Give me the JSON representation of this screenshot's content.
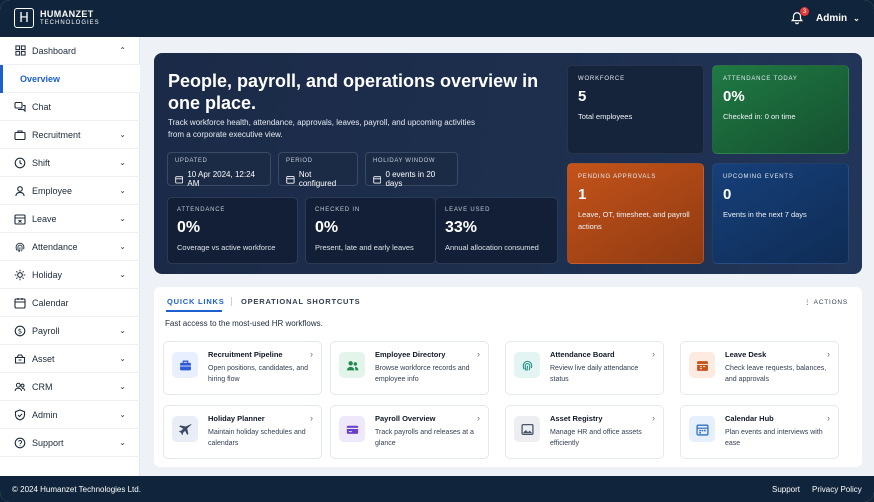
{
  "brand": {
    "main": "HUMANZET",
    "sub": "TECHNOLOGIES",
    "mark": "H"
  },
  "header": {
    "notification_count": "3",
    "user_label": "Admin"
  },
  "sidebar": {
    "items": [
      {
        "label": "Dashboard",
        "icon": "grid-icon"
      },
      {
        "label": "Overview",
        "icon": ""
      },
      {
        "label": "Chat",
        "icon": "chat-icon"
      },
      {
        "label": "Recruitment",
        "icon": "briefcase-icon"
      },
      {
        "label": "Shift",
        "icon": "clock-icon"
      },
      {
        "label": "Employee",
        "icon": "user-icon"
      },
      {
        "label": "Leave",
        "icon": "calendar-x-icon"
      },
      {
        "label": "Attendance",
        "icon": "fingerprint-icon"
      },
      {
        "label": "Holiday",
        "icon": "sun-icon"
      },
      {
        "label": "Calendar",
        "icon": "calendar-icon"
      },
      {
        "label": "Payroll",
        "icon": "dollar-icon"
      },
      {
        "label": "Asset",
        "icon": "box-icon"
      },
      {
        "label": "CRM",
        "icon": "users-icon"
      },
      {
        "label": "Admin",
        "icon": "shield-icon"
      },
      {
        "label": "Support",
        "icon": "help-icon"
      }
    ]
  },
  "hero": {
    "title": "People, payroll, and operations overview in one place.",
    "description": "Track workforce health, attendance, approvals, leaves, payroll, and upcoming activities from a corporate executive view.",
    "meta": [
      {
        "key": "UPDATED",
        "value": "10 Apr 2024, 12:24 AM"
      },
      {
        "key": "PERIOD",
        "value": "Not configured"
      },
      {
        "key": "HOLIDAY WINDOW",
        "value": "0 events in 20 days"
      }
    ],
    "stats": [
      {
        "key": "ATTENDANCE",
        "value": "0%",
        "desc": "Coverage vs active workforce"
      },
      {
        "key": "CHECKED IN",
        "value": "0%",
        "desc": "Present, late and early leaves"
      },
      {
        "key": "LEAVE USED",
        "value": "33%",
        "desc": "Annual allocation consumed"
      }
    ],
    "kpis": [
      {
        "key": "WORKFORCE",
        "value": "5",
        "desc": "Total employees",
        "color": "#15233b"
      },
      {
        "key": "ATTENDANCE TODAY",
        "value": "0%",
        "desc": "Checked in: 0 on time",
        "color": "#1b6a3a"
      },
      {
        "key": "PENDING APPROVALS",
        "value": "1",
        "desc": "Leave, OT, timesheet, and payroll actions",
        "color": "#b4480f"
      },
      {
        "key": "UPCOMING EVENTS",
        "value": "0",
        "desc": "Events in the next 7 days",
        "color": "#123766"
      }
    ]
  },
  "quick": {
    "tab_active": "QUICK LINKS",
    "tab_other": "OPERATIONAL SHORTCUTS",
    "actions": "ACTIONS",
    "subtitle": "Fast access to the most-used HR workflows.",
    "cards": [
      {
        "title": "Recruitment Pipeline",
        "desc": "Open positions, candidates, and hiring flow",
        "icon": "briefcase-icon",
        "bg": "#e8efff",
        "fg": "#2f5bd8"
      },
      {
        "title": "Employee Directory",
        "desc": "Browse workforce records and employee info",
        "icon": "people-icon",
        "bg": "#e3f5ea",
        "fg": "#1f8a4c"
      },
      {
        "title": "Attendance Board",
        "desc": "Review live daily attendance status",
        "icon": "fingerprint-icon",
        "bg": "#e3f4f3",
        "fg": "#1d8f88"
      },
      {
        "title": "Leave Desk",
        "desc": "Check leave requests, balances, and approvals",
        "icon": "calendar-icon",
        "bg": "#fdebe2",
        "fg": "#c2531a"
      },
      {
        "title": "Holiday Planner",
        "desc": "Maintain holiday schedules and calendars",
        "icon": "plane-icon",
        "bg": "#e9edf5",
        "fg": "#3b4a66"
      },
      {
        "title": "Payroll Overview",
        "desc": "Track payrolls and releases at a glance",
        "icon": "card-icon",
        "bg": "#efe8fb",
        "fg": "#6a3fc8"
      },
      {
        "title": "Asset Registry",
        "desc": "Manage HR and office assets efficiently",
        "icon": "image-icon",
        "bg": "#eceef2",
        "fg": "#4a5568"
      },
      {
        "title": "Calendar Hub",
        "desc": "Plan events and interviews with ease",
        "icon": "calendar-grid-icon",
        "bg": "#e6f0fc",
        "fg": "#2f6fc0"
      }
    ]
  },
  "footer": {
    "copyright": "© 2024 Humanzet Technologies Ltd.",
    "support": "Support",
    "privacy": "Privacy Policy"
  }
}
